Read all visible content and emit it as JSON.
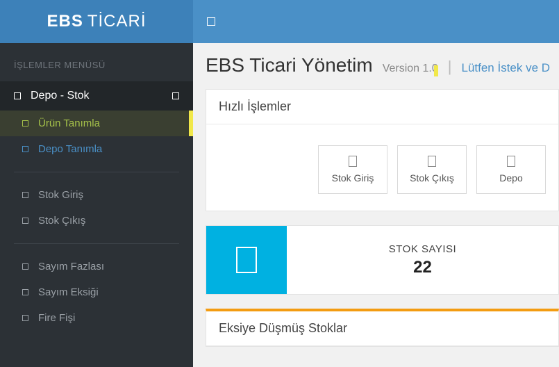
{
  "brand": {
    "bold": "EBS",
    "light": "TİCARİ"
  },
  "sidebar": {
    "sectionTitle": "İŞLEMLER MENÜSÜ",
    "parent": "Depo - Stok",
    "g1": [
      {
        "label": "Ürün Tanımla"
      },
      {
        "label": "Depo Tanımla"
      }
    ],
    "g2": [
      {
        "label": "Stok Giriş"
      },
      {
        "label": "Stok Çıkış"
      }
    ],
    "g3": [
      {
        "label": "Sayım Fazlası"
      },
      {
        "label": "Sayım Eksiği"
      },
      {
        "label": "Fire Fişi"
      }
    ]
  },
  "page": {
    "title": "EBS Ticari Yönetim",
    "version": "Version 1.0",
    "requestLink": "Lütfen İstek ve D"
  },
  "quick": {
    "title": "Hızlı İşlemler",
    "buttons": [
      {
        "label": "Stok Giriş"
      },
      {
        "label": "Stok Çıkış"
      },
      {
        "label": "Depo"
      }
    ]
  },
  "stat": {
    "label": "STOK SAYISI",
    "value": "22"
  },
  "negative": {
    "title": "Eksiye Düşmüş Stoklar"
  }
}
